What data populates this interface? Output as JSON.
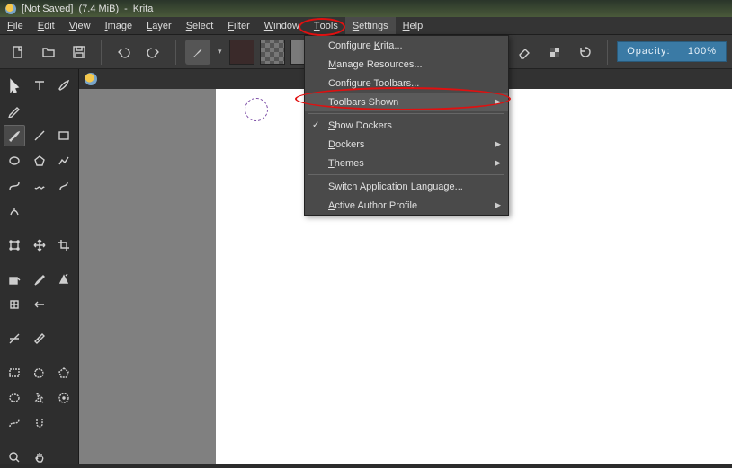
{
  "title": {
    "doc_status": "[Not Saved]",
    "size": "(7.4 MiB)",
    "sep": "-",
    "app": "Krita"
  },
  "menubar": {
    "items": [
      "File",
      "Edit",
      "View",
      "Image",
      "Layer",
      "Select",
      "Filter",
      "Window",
      "Tools",
      "Settings",
      "Help"
    ],
    "active_index": 9
  },
  "toolbar": {
    "opacity_label": "Opacity:",
    "opacity_value": "100%"
  },
  "dropdown": {
    "items": [
      {
        "label": "Configure Krita...",
        "u": 10
      },
      {
        "label": "Manage Resources...",
        "u": 0
      },
      {
        "label": "Configure Toolbars...",
        "u": 18
      },
      {
        "label": "Toolbars Shown",
        "u": 0,
        "submenu": true,
        "hover": true
      },
      {
        "sep": true
      },
      {
        "label": "Show Dockers",
        "u": 0,
        "checked": true
      },
      {
        "label": "Dockers",
        "u": 0,
        "submenu": true
      },
      {
        "label": "Themes",
        "u": 0,
        "submenu": true
      },
      {
        "sep": true
      },
      {
        "label": "Switch Application Language...",
        "u": -1
      },
      {
        "label": "Active Author Profile",
        "u": 0,
        "submenu": true
      }
    ]
  },
  "tools": {
    "rows": [
      [
        "cursor",
        "text",
        "calligraphy"
      ],
      [
        "pencil"
      ],
      [
        "brush",
        "line",
        "rect"
      ],
      [
        "ellipse",
        "polygon",
        "polyline"
      ],
      [
        "bezier",
        "freehand",
        "dynamic"
      ],
      [
        "multibrush"
      ],
      [],
      [
        "transform",
        "move",
        "crop"
      ],
      [],
      [
        "fill",
        "color-picker",
        "smart-fill"
      ],
      [
        "patch",
        "gradient"
      ],
      [],
      [
        "assist",
        "measure"
      ],
      [],
      [
        "rect-select",
        "free-select",
        "poly-select"
      ],
      [
        "ellipse-select",
        "contig-select",
        "color-select"
      ],
      [
        "bezier-select",
        "magnetic-select"
      ],
      [],
      [
        "zoom",
        "pan"
      ]
    ],
    "selected": "brush"
  }
}
